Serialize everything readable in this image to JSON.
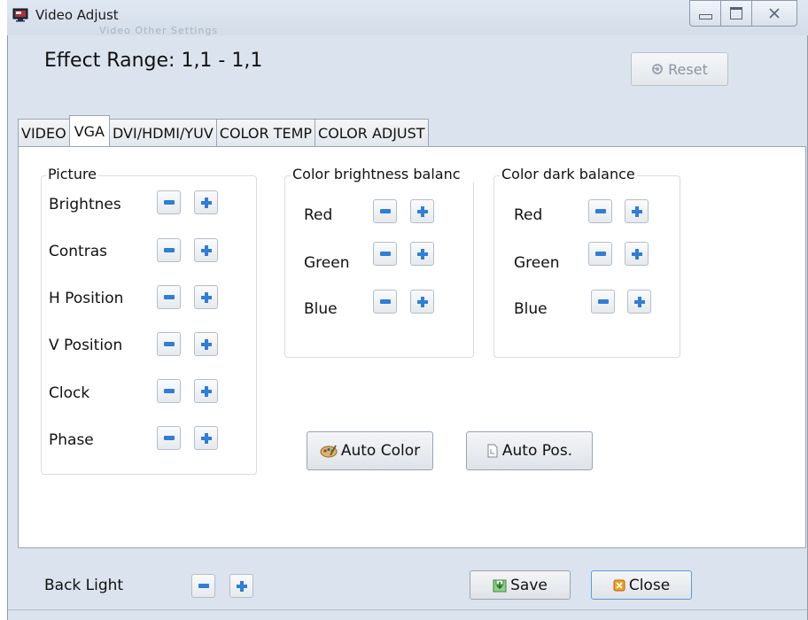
{
  "window": {
    "title": "Video Adjust",
    "ghost_text": "Video   Other Settings"
  },
  "header": {
    "effect_range": "Effect Range: 1,1 - 1,1",
    "reset_label": "Reset"
  },
  "tabs": [
    "VIDEO",
    "VGA",
    "DVI/HDMI/YUV",
    "COLOR TEMP",
    "COLOR ADJUST"
  ],
  "active_tab": "VGA",
  "picture": {
    "title": "Picture",
    "items": [
      "Brightnes",
      "Contras",
      "H Position",
      "V Position",
      "Clock",
      "Phase"
    ]
  },
  "color_brightness": {
    "title": "Color brightness balanc",
    "items": [
      "Red",
      "Green",
      "Blue"
    ]
  },
  "color_dark": {
    "title": "Color dark balance",
    "items": [
      "Red",
      "Green",
      "Blue"
    ]
  },
  "actions": {
    "auto_color": "Auto Color",
    "auto_pos": "Auto Pos."
  },
  "footer": {
    "back_light": "Back Light",
    "save": "Save",
    "close": "Close"
  },
  "colors": {
    "accent": "#2f7ed8",
    "window_bg": "#dbe4ee",
    "close_icon": "#f0a020"
  }
}
